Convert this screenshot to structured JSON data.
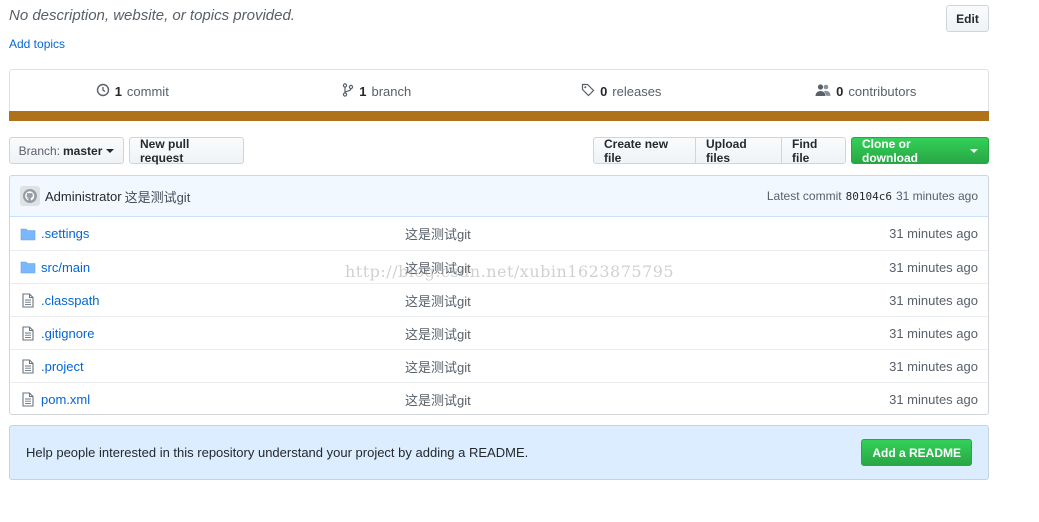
{
  "repo": {
    "description": "No description, website, or topics provided.",
    "add_topics": "Add topics",
    "edit_label": "Edit"
  },
  "summary": {
    "commits_count": "1",
    "commits_label": "commit",
    "branches_count": "1",
    "branches_label": "branch",
    "releases_count": "0",
    "releases_label": "releases",
    "contributors_count": "0",
    "contributors_label": "contributors",
    "language_color": "#b07219"
  },
  "toolbar": {
    "branch_prefix": "Branch:",
    "branch_name": "master",
    "new_pr": "New pull request",
    "create_file": "Create new file",
    "upload_files": "Upload files",
    "find_file": "Find file",
    "clone": "Clone or download"
  },
  "commit": {
    "author": "Administrator",
    "message": "这是测试git",
    "latest_label": "Latest commit",
    "sha": "80104c6",
    "age": "31 minutes ago"
  },
  "files": [
    {
      "name": ".settings",
      "type": "folder",
      "message": "这是测试git",
      "age": "31 minutes ago"
    },
    {
      "name": "src/main",
      "type": "folder",
      "message": "这是测试git",
      "age": "31 minutes ago"
    },
    {
      "name": ".classpath",
      "type": "file",
      "message": "这是测试git",
      "age": "31 minutes ago"
    },
    {
      "name": ".gitignore",
      "type": "file",
      "message": "这是测试git",
      "age": "31 minutes ago"
    },
    {
      "name": ".project",
      "type": "file",
      "message": "这是测试git",
      "age": "31 minutes ago"
    },
    {
      "name": "pom.xml",
      "type": "file",
      "message": "这是测试git",
      "age": "31 minutes ago"
    }
  ],
  "readme": {
    "text": "Help people interested in this repository understand your project by adding a README.",
    "button": "Add a README"
  },
  "watermark": "http://blog.csdn.net/xubin1623875795",
  "colors": {
    "link": "#0366d6",
    "green": "#28a745",
    "readme_bg": "#dbedff"
  }
}
